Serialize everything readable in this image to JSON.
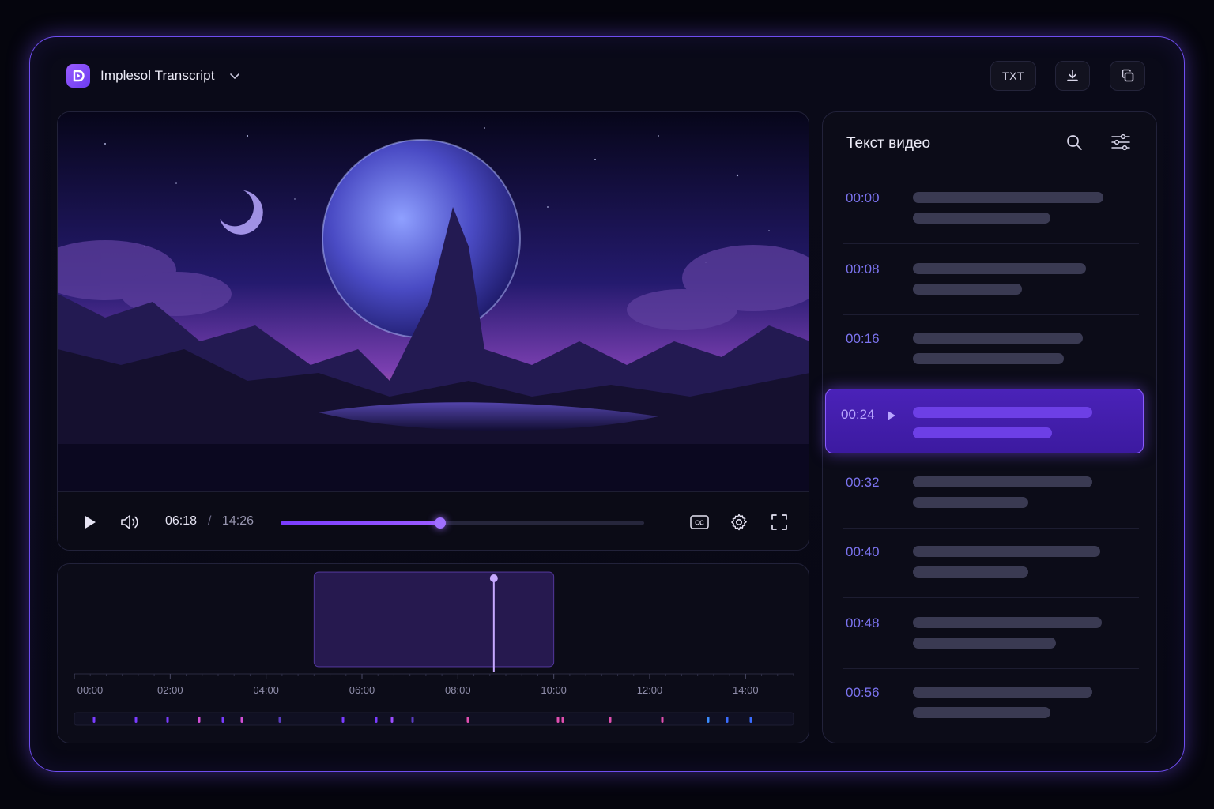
{
  "app": {
    "title": "Implesol Transcript"
  },
  "toolbar": {
    "txt_label": "TXT",
    "download_icon": "download-icon",
    "copy_icon": "copy-icon"
  },
  "player": {
    "current_time": "06:18",
    "separator": "/",
    "total_time": "14:26",
    "progress": 0.44,
    "icons": [
      "play-icon",
      "volume-icon",
      "cc-icon",
      "gear-icon",
      "fullscreen-icon"
    ]
  },
  "waveform": {
    "selection": {
      "start": "05:00",
      "end": "10:00"
    },
    "playhead": "08:45",
    "ticks": [
      "00:00",
      "02:00",
      "04:00",
      "06:00",
      "08:00",
      "10:00",
      "12:00",
      "14:00"
    ]
  },
  "transcript": {
    "title": "Текст видео",
    "active_index": 3,
    "items": [
      {
        "time": "00:00"
      },
      {
        "time": "00:08"
      },
      {
        "time": "00:16"
      },
      {
        "time": "00:24"
      },
      {
        "time": "00:32"
      },
      {
        "time": "00:40"
      },
      {
        "time": "00:48"
      },
      {
        "time": "00:56"
      }
    ]
  },
  "colors": {
    "accent": "#8a5cff",
    "accent_dark": "#4a22b8",
    "timestamp": "#7c74f0",
    "frame_border": "#6f4ef0"
  }
}
